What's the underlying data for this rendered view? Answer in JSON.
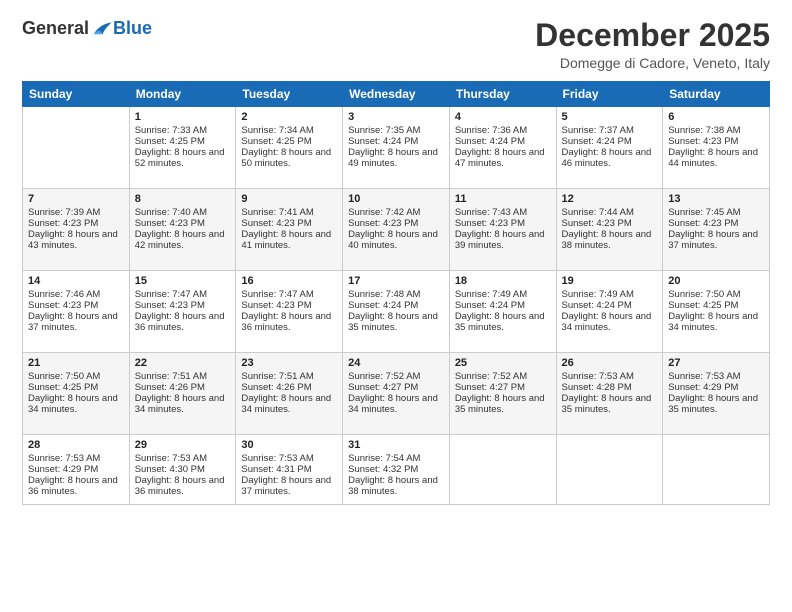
{
  "logo": {
    "general": "General",
    "blue": "Blue"
  },
  "header": {
    "month": "December 2025",
    "location": "Domegge di Cadore, Veneto, Italy"
  },
  "days": [
    "Sunday",
    "Monday",
    "Tuesday",
    "Wednesday",
    "Thursday",
    "Friday",
    "Saturday"
  ],
  "weeks": [
    [
      {
        "day": "",
        "sunrise": "",
        "sunset": "",
        "daylight": ""
      },
      {
        "day": "1",
        "sunrise": "Sunrise: 7:33 AM",
        "sunset": "Sunset: 4:25 PM",
        "daylight": "Daylight: 8 hours and 52 minutes."
      },
      {
        "day": "2",
        "sunrise": "Sunrise: 7:34 AM",
        "sunset": "Sunset: 4:25 PM",
        "daylight": "Daylight: 8 hours and 50 minutes."
      },
      {
        "day": "3",
        "sunrise": "Sunrise: 7:35 AM",
        "sunset": "Sunset: 4:24 PM",
        "daylight": "Daylight: 8 hours and 49 minutes."
      },
      {
        "day": "4",
        "sunrise": "Sunrise: 7:36 AM",
        "sunset": "Sunset: 4:24 PM",
        "daylight": "Daylight: 8 hours and 47 minutes."
      },
      {
        "day": "5",
        "sunrise": "Sunrise: 7:37 AM",
        "sunset": "Sunset: 4:24 PM",
        "daylight": "Daylight: 8 hours and 46 minutes."
      },
      {
        "day": "6",
        "sunrise": "Sunrise: 7:38 AM",
        "sunset": "Sunset: 4:23 PM",
        "daylight": "Daylight: 8 hours and 44 minutes."
      }
    ],
    [
      {
        "day": "7",
        "sunrise": "Sunrise: 7:39 AM",
        "sunset": "Sunset: 4:23 PM",
        "daylight": "Daylight: 8 hours and 43 minutes."
      },
      {
        "day": "8",
        "sunrise": "Sunrise: 7:40 AM",
        "sunset": "Sunset: 4:23 PM",
        "daylight": "Daylight: 8 hours and 42 minutes."
      },
      {
        "day": "9",
        "sunrise": "Sunrise: 7:41 AM",
        "sunset": "Sunset: 4:23 PM",
        "daylight": "Daylight: 8 hours and 41 minutes."
      },
      {
        "day": "10",
        "sunrise": "Sunrise: 7:42 AM",
        "sunset": "Sunset: 4:23 PM",
        "daylight": "Daylight: 8 hours and 40 minutes."
      },
      {
        "day": "11",
        "sunrise": "Sunrise: 7:43 AM",
        "sunset": "Sunset: 4:23 PM",
        "daylight": "Daylight: 8 hours and 39 minutes."
      },
      {
        "day": "12",
        "sunrise": "Sunrise: 7:44 AM",
        "sunset": "Sunset: 4:23 PM",
        "daylight": "Daylight: 8 hours and 38 minutes."
      },
      {
        "day": "13",
        "sunrise": "Sunrise: 7:45 AM",
        "sunset": "Sunset: 4:23 PM",
        "daylight": "Daylight: 8 hours and 37 minutes."
      }
    ],
    [
      {
        "day": "14",
        "sunrise": "Sunrise: 7:46 AM",
        "sunset": "Sunset: 4:23 PM",
        "daylight": "Daylight: 8 hours and 37 minutes."
      },
      {
        "day": "15",
        "sunrise": "Sunrise: 7:47 AM",
        "sunset": "Sunset: 4:23 PM",
        "daylight": "Daylight: 8 hours and 36 minutes."
      },
      {
        "day": "16",
        "sunrise": "Sunrise: 7:47 AM",
        "sunset": "Sunset: 4:23 PM",
        "daylight": "Daylight: 8 hours and 36 minutes."
      },
      {
        "day": "17",
        "sunrise": "Sunrise: 7:48 AM",
        "sunset": "Sunset: 4:24 PM",
        "daylight": "Daylight: 8 hours and 35 minutes."
      },
      {
        "day": "18",
        "sunrise": "Sunrise: 7:49 AM",
        "sunset": "Sunset: 4:24 PM",
        "daylight": "Daylight: 8 hours and 35 minutes."
      },
      {
        "day": "19",
        "sunrise": "Sunrise: 7:49 AM",
        "sunset": "Sunset: 4:24 PM",
        "daylight": "Daylight: 8 hours and 34 minutes."
      },
      {
        "day": "20",
        "sunrise": "Sunrise: 7:50 AM",
        "sunset": "Sunset: 4:25 PM",
        "daylight": "Daylight: 8 hours and 34 minutes."
      }
    ],
    [
      {
        "day": "21",
        "sunrise": "Sunrise: 7:50 AM",
        "sunset": "Sunset: 4:25 PM",
        "daylight": "Daylight: 8 hours and 34 minutes."
      },
      {
        "day": "22",
        "sunrise": "Sunrise: 7:51 AM",
        "sunset": "Sunset: 4:26 PM",
        "daylight": "Daylight: 8 hours and 34 minutes."
      },
      {
        "day": "23",
        "sunrise": "Sunrise: 7:51 AM",
        "sunset": "Sunset: 4:26 PM",
        "daylight": "Daylight: 8 hours and 34 minutes."
      },
      {
        "day": "24",
        "sunrise": "Sunrise: 7:52 AM",
        "sunset": "Sunset: 4:27 PM",
        "daylight": "Daylight: 8 hours and 34 minutes."
      },
      {
        "day": "25",
        "sunrise": "Sunrise: 7:52 AM",
        "sunset": "Sunset: 4:27 PM",
        "daylight": "Daylight: 8 hours and 35 minutes."
      },
      {
        "day": "26",
        "sunrise": "Sunrise: 7:53 AM",
        "sunset": "Sunset: 4:28 PM",
        "daylight": "Daylight: 8 hours and 35 minutes."
      },
      {
        "day": "27",
        "sunrise": "Sunrise: 7:53 AM",
        "sunset": "Sunset: 4:29 PM",
        "daylight": "Daylight: 8 hours and 35 minutes."
      }
    ],
    [
      {
        "day": "28",
        "sunrise": "Sunrise: 7:53 AM",
        "sunset": "Sunset: 4:29 PM",
        "daylight": "Daylight: 8 hours and 36 minutes."
      },
      {
        "day": "29",
        "sunrise": "Sunrise: 7:53 AM",
        "sunset": "Sunset: 4:30 PM",
        "daylight": "Daylight: 8 hours and 36 minutes."
      },
      {
        "day": "30",
        "sunrise": "Sunrise: 7:53 AM",
        "sunset": "Sunset: 4:31 PM",
        "daylight": "Daylight: 8 hours and 37 minutes."
      },
      {
        "day": "31",
        "sunrise": "Sunrise: 7:54 AM",
        "sunset": "Sunset: 4:32 PM",
        "daylight": "Daylight: 8 hours and 38 minutes."
      },
      {
        "day": "",
        "sunrise": "",
        "sunset": "",
        "daylight": ""
      },
      {
        "day": "",
        "sunrise": "",
        "sunset": "",
        "daylight": ""
      },
      {
        "day": "",
        "sunrise": "",
        "sunset": "",
        "daylight": ""
      }
    ]
  ]
}
